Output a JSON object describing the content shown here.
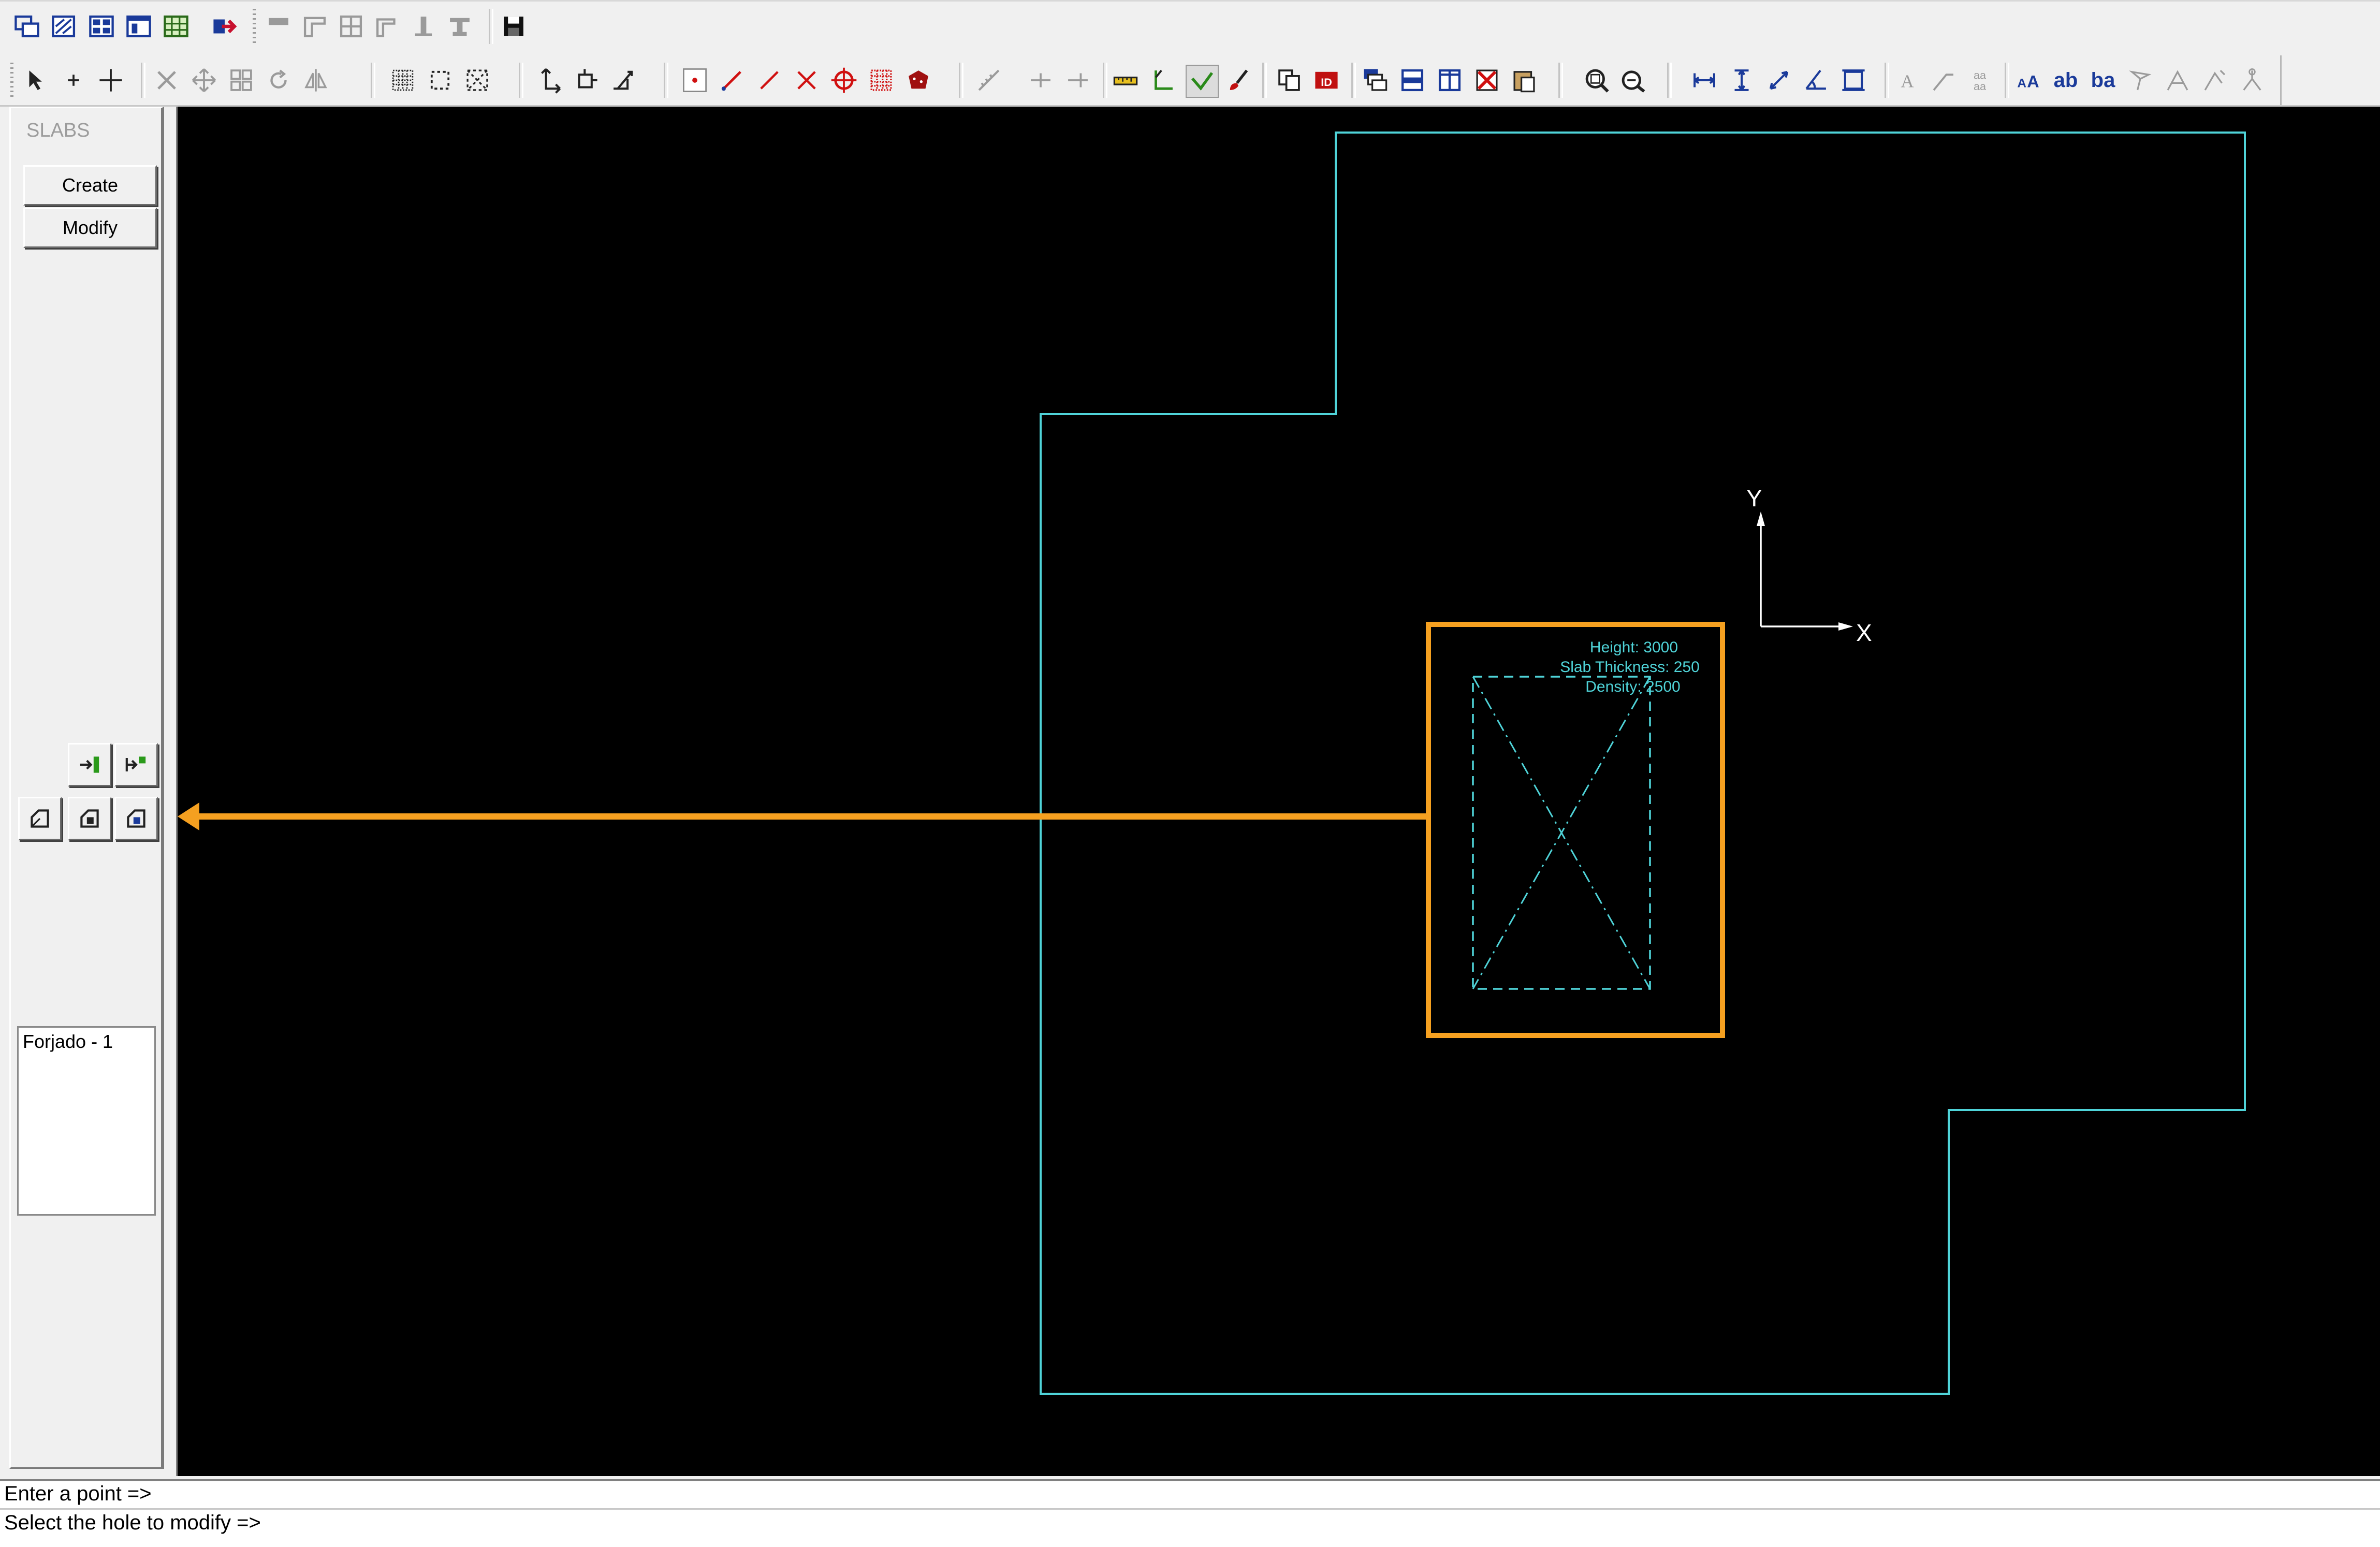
{
  "toolbar_top": {
    "icons": [
      "new-window-icon",
      "hatch-window-icon",
      "tile-windows-icon",
      "layout-window-icon",
      "table-icon",
      "export-icon",
      "wall-icon",
      "corner-icon",
      "grid-icon",
      "stair-icon",
      "column-icon",
      "beam-icon",
      "save-icon"
    ]
  },
  "toolbar_main": {
    "icons": [
      "select-arrow-icon",
      "small-cross-icon",
      "large-cross-icon",
      "delete-icon",
      "move-icon",
      "copy-array-icon",
      "rotate-icon",
      "mirror-icon",
      "dense-grid-icon",
      "window-select-icon",
      "cross-select-icon",
      "move-point-icon",
      "stretch-icon",
      "scale-icon",
      "point-icon",
      "line-icon",
      "segment-icon",
      "x-icon",
      "circle-target-icon",
      "dot-grid-icon",
      "fill-icon",
      "ruler-icon",
      "split-icon",
      "join-icon",
      "measure-icon",
      "angle-icon",
      "check-icon",
      "brush-icon",
      "duplicate-icon",
      "id-icon",
      "layers-icon",
      "rows-icon",
      "columns-icon",
      "delete-layer-icon",
      "paste-icon",
      "zoom-window-icon",
      "zoom-all-icon",
      "dim-horizontal-icon",
      "dim-vertical-icon",
      "dim-aligned-icon",
      "dim-angle-icon",
      "dim-frame-icon",
      "text-icon",
      "leader-icon",
      "text-style-icon",
      "font-size-icon",
      "text-ab-icon",
      "text-ba-icon",
      "arrow-icon",
      "angle-arrow-icon",
      "snap-icon",
      "node-icon"
    ],
    "text_ab": "ab",
    "text_ba": "ba"
  },
  "left_panel": {
    "title": "SLABS",
    "create_label": "Create",
    "modify_label": "Modify",
    "slab_items": [
      "Forjado - 1"
    ]
  },
  "canvas": {
    "axis_x_label": "X",
    "axis_y_label": "Y",
    "hole_info": {
      "height": "Height: 3000",
      "thickness": "Slab Thickness: 250",
      "density": "Density: 2500"
    },
    "colors": {
      "background": "#000000",
      "outline": "#4fd3d8",
      "highlight": "#f5a020",
      "axis": "#ffffff"
    }
  },
  "command": {
    "line1": "Enter a point =>",
    "line2": "Select the hole to modify =>"
  }
}
